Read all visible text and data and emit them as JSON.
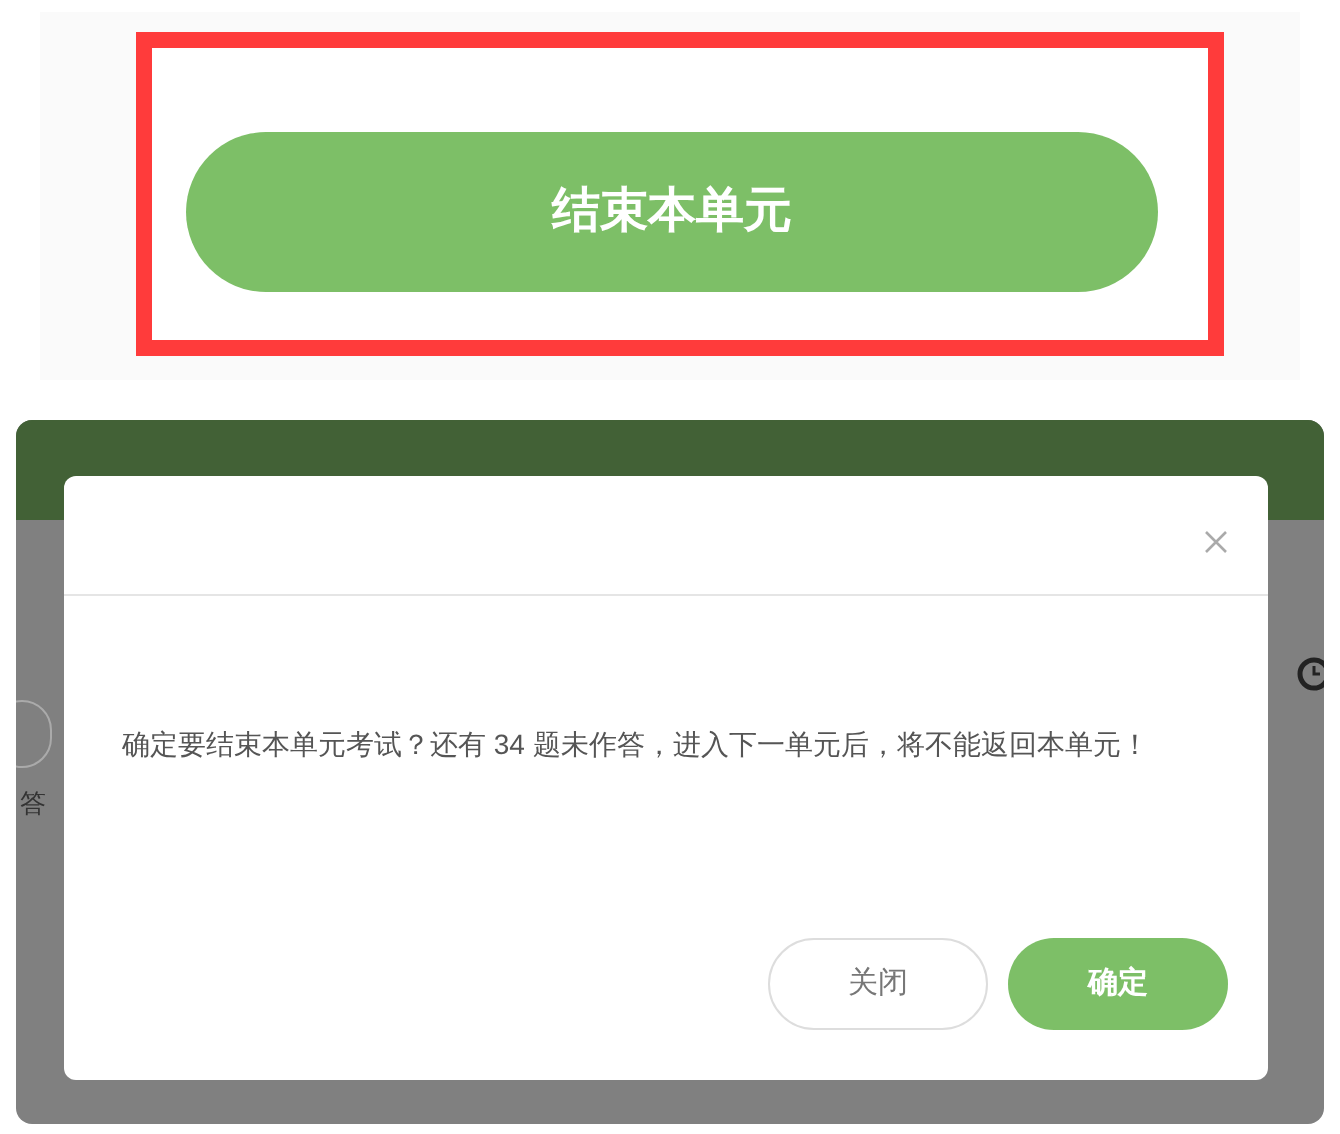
{
  "top_panel": {
    "button": "结束本单元"
  },
  "background": {
    "partial_label": "答"
  },
  "dialog": {
    "message": "确定要结束本单元考试？还有 34 题未作答，进入下一单元后，将不能返回本单元！",
    "buttons": [
      {
        "label": "关闭",
        "kind": "secondary"
      },
      {
        "label": "确定",
        "kind": "primary"
      }
    ]
  }
}
